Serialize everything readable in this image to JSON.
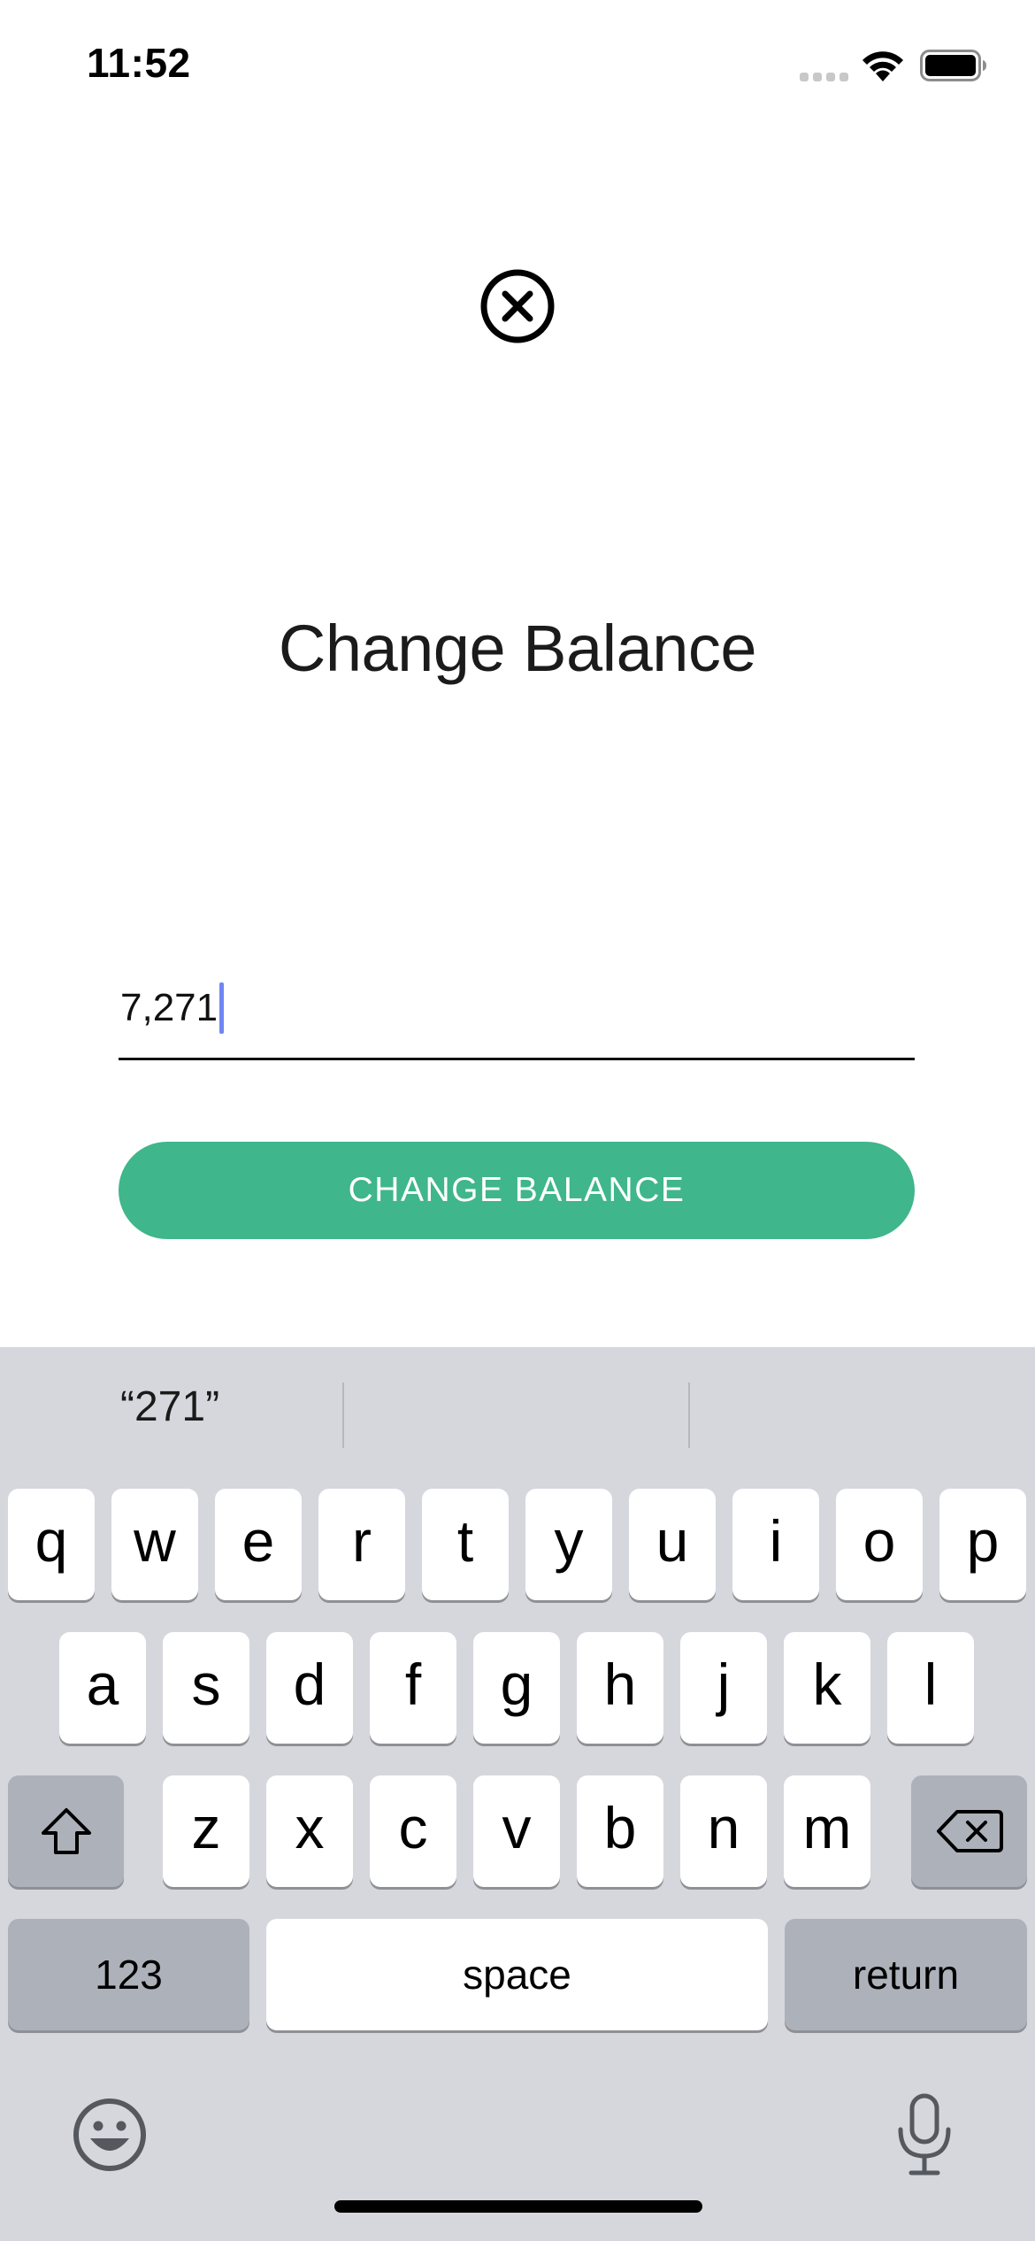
{
  "status_bar": {
    "time": "11:52",
    "icons": [
      "cellular-signal-icon",
      "wifi-icon",
      "battery-icon"
    ]
  },
  "modal": {
    "close_icon": "close-circle-icon",
    "title": "Change Balance",
    "balance_input": {
      "value": "7,271"
    },
    "submit_label": "CHANGE BALANCE"
  },
  "colors": {
    "accent_green": "#3fb68b",
    "caret_blue": "#6f86f2",
    "keyboard_bg": "#d5d7dd",
    "key_dark": "#adb1ba"
  },
  "keyboard": {
    "suggestions": [
      "“271”",
      "",
      ""
    ],
    "row1": [
      "q",
      "w",
      "e",
      "r",
      "t",
      "y",
      "u",
      "i",
      "o",
      "p"
    ],
    "row2": [
      "a",
      "s",
      "d",
      "f",
      "g",
      "h",
      "j",
      "k",
      "l"
    ],
    "row3": [
      "z",
      "x",
      "c",
      "v",
      "b",
      "n",
      "m"
    ],
    "numbers_label": "123",
    "space_label": "space",
    "return_label": "return",
    "icons": [
      "shift-icon",
      "backspace-icon",
      "emoji-icon",
      "microphone-icon"
    ]
  }
}
